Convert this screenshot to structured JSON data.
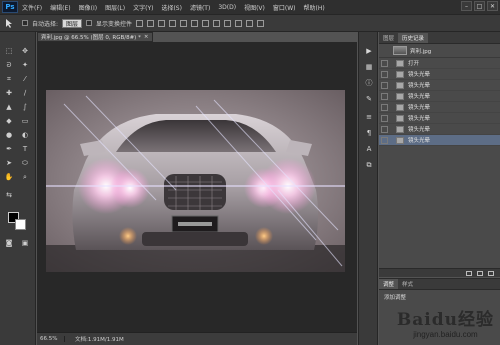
{
  "app": {
    "logo": "Ps"
  },
  "menu": [
    "文件(F)",
    "编辑(E)",
    "图像(I)",
    "图层(L)",
    "文字(Y)",
    "选择(S)",
    "滤镜(T)",
    "3D(D)",
    "视图(V)",
    "窗口(W)",
    "帮助(H)"
  ],
  "window_controls": [
    "–",
    "□",
    "✕"
  ],
  "options_bar": {
    "auto_select_label": "自动选择:",
    "auto_select_value": "图层",
    "show_transform_label": "显示变换控件"
  },
  "document": {
    "tab_title": "宾利.jpg @ 66.5% (图层 0, RGB/8#) *",
    "tab_close": "×",
    "zoom": "66.5%",
    "doc_info": "文档:1.91M/1.91M"
  },
  "history": {
    "tabs": [
      "图层",
      "历史记录"
    ],
    "snapshot_label": "宾利.jpg",
    "items": [
      "打开",
      "镜头光晕",
      "镜头光晕",
      "镜头光晕",
      "镜头光晕",
      "镜头光晕",
      "镜头光晕",
      "镜头光晕"
    ],
    "selected_index": 7
  },
  "adjustments": {
    "tabs": [
      "调整",
      "样式"
    ],
    "add_label": "添加调整"
  },
  "watermark": {
    "logo": "Baidu经验",
    "url": "jingyan.baidu.com"
  },
  "colors": {
    "menubar": "#2f2f2f",
    "panel": "#4a4a4a",
    "selected_row": "#5d6d86",
    "canvas": "#282828"
  }
}
